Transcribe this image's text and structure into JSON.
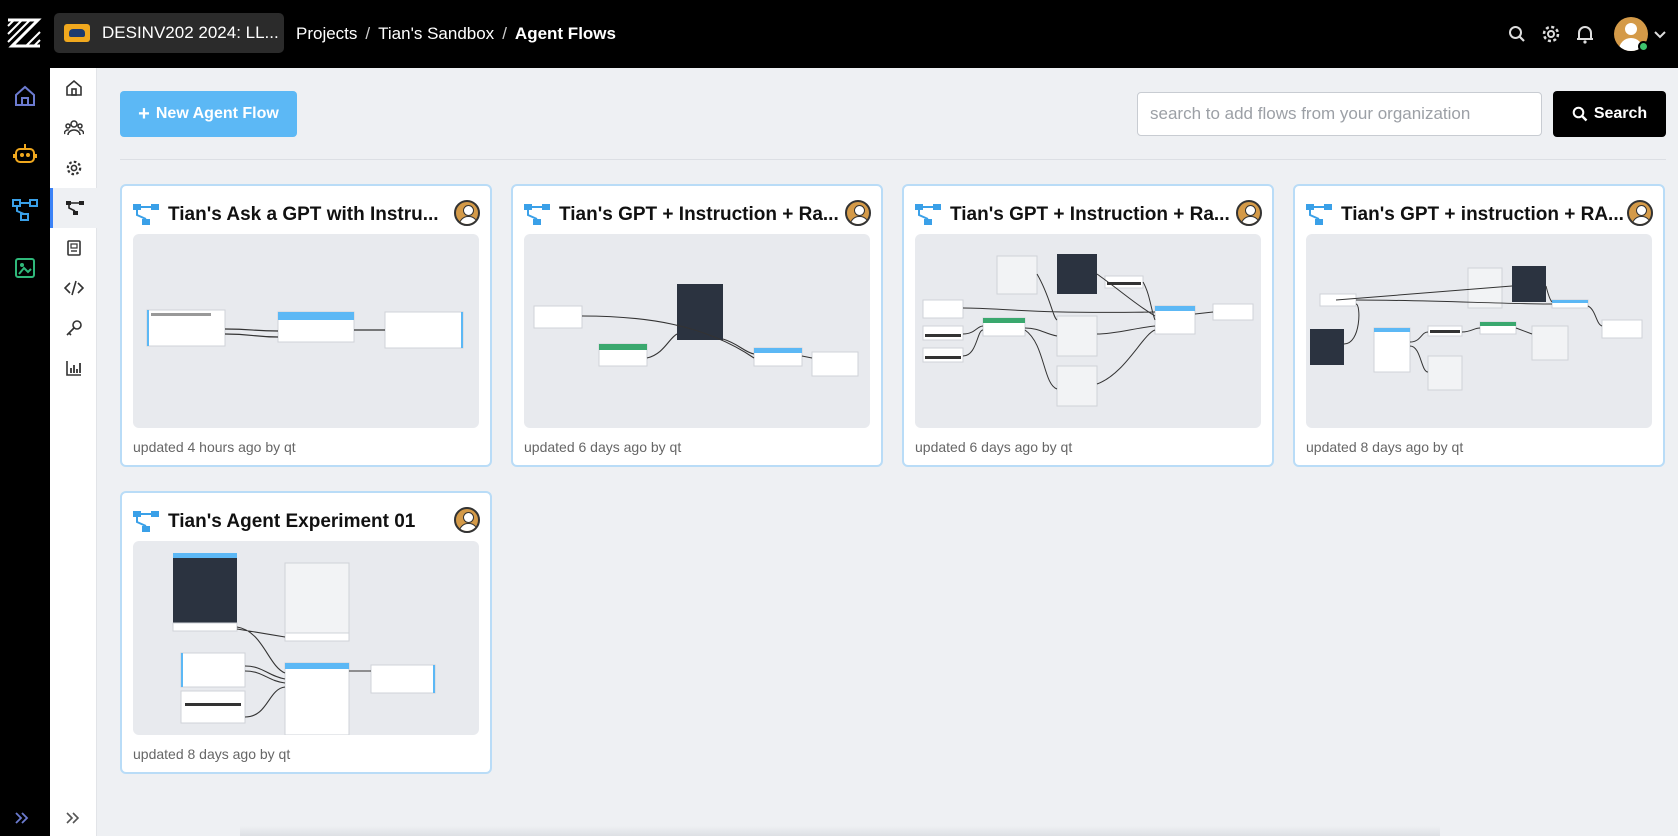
{
  "app": {
    "project_selector": "DESINV202 2024: LL...",
    "breadcrumb": {
      "projects": "Projects",
      "sandbox": "Tian's Sandbox",
      "current": "Agent Flows"
    },
    "accent_color": "#5cb8f5"
  },
  "topbar_icons": [
    "search-icon",
    "gear-icon",
    "bell-icon",
    "avatar",
    "chevron-down-icon"
  ],
  "rail_items": [
    "home-icon",
    "robot-icon",
    "flow-icon",
    "dataset-icon"
  ],
  "sidebar_items": [
    "home-icon",
    "users-icon",
    "settings-icon",
    "flows-icon",
    "book-icon",
    "code-icon",
    "key-icon",
    "analytics-icon"
  ],
  "toolbar": {
    "new_label": "New Agent Flow",
    "search_placeholder": "search to add flows from your organization",
    "search_label": "Search"
  },
  "flows": [
    {
      "title": "Tian's Ask a GPT with Instru...",
      "meta": "updated 4 hours ago by qt"
    },
    {
      "title": "Tian's GPT + Instruction + Ra...",
      "meta": "updated 6 days ago by qt"
    },
    {
      "title": "Tian's GPT + Instruction + Ra...",
      "meta": "updated 6 days ago by qt"
    },
    {
      "title": "Tian's GPT + instruction + RA...",
      "meta": "updated 8 days ago by qt"
    },
    {
      "title": "Tian's Agent Experiment 01",
      "meta": "updated 8 days ago by qt"
    }
  ]
}
